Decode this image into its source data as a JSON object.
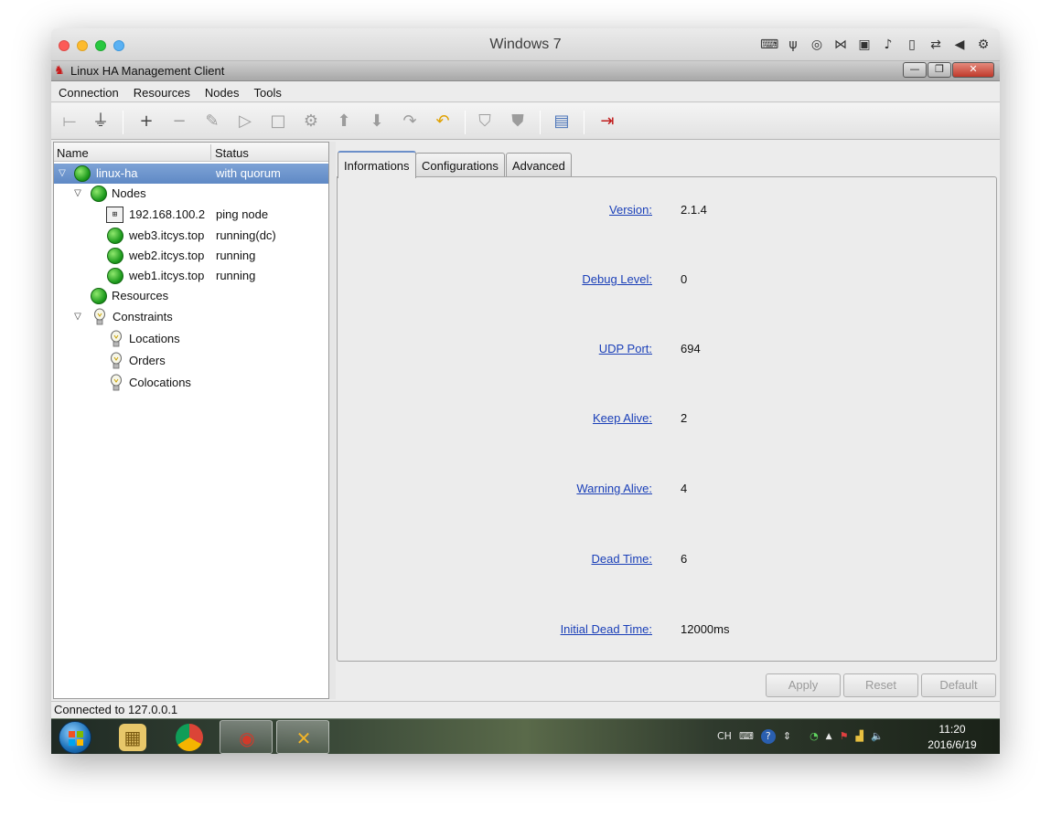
{
  "mac": {
    "title": "Windows 7",
    "tool_icons": [
      "keyboard-icon",
      "usb-icon",
      "cd-icon",
      "network-icon",
      "disk-icon",
      "sound-icon",
      "phone-icon",
      "shared-folder-icon",
      "back-icon",
      "settings-icon"
    ]
  },
  "window": {
    "title": "Linux HA Management Client",
    "min_label": "—",
    "max_label": "❐",
    "close_label": "✕"
  },
  "menu": [
    "Connection",
    "Resources",
    "Nodes",
    "Tools"
  ],
  "tree": {
    "col_name": "Name",
    "col_status": "Status",
    "rows": [
      {
        "name": "linux-ha",
        "status": "with quorum"
      },
      {
        "name": "Nodes",
        "status": ""
      },
      {
        "name": "192.168.100.2",
        "status": "ping node"
      },
      {
        "name": "web3.itcys.top",
        "status": "running(dc)"
      },
      {
        "name": "web2.itcys.top",
        "status": "running"
      },
      {
        "name": "web1.itcys.top",
        "status": "running"
      },
      {
        "name": "Resources",
        "status": ""
      },
      {
        "name": "Constraints",
        "status": ""
      },
      {
        "name": "Locations",
        "status": ""
      },
      {
        "name": "Orders",
        "status": ""
      },
      {
        "name": "Colocations",
        "status": ""
      }
    ]
  },
  "tabs": [
    "Informations",
    "Configurations",
    "Advanced"
  ],
  "properties": [
    {
      "label": "Version:",
      "value": "2.1.4"
    },
    {
      "label": "Debug Level:",
      "value": "0"
    },
    {
      "label": "UDP Port:",
      "value": "694"
    },
    {
      "label": "Keep Alive:",
      "value": "2"
    },
    {
      "label": "Warning Alive:",
      "value": "4"
    },
    {
      "label": "Dead Time:",
      "value": "6"
    },
    {
      "label": "Initial Dead Time:",
      "value": "12000ms"
    }
  ],
  "actions": {
    "apply": "Apply",
    "reset": "Reset",
    "default": "Default"
  },
  "status_bar": "Connected to 127.0.0.1",
  "taskbar": {
    "tray_lang": "CH",
    "tray_help": "?",
    "tray_arrow": "▲",
    "clock_time": "11:20",
    "clock_date": "2016/6/19"
  }
}
